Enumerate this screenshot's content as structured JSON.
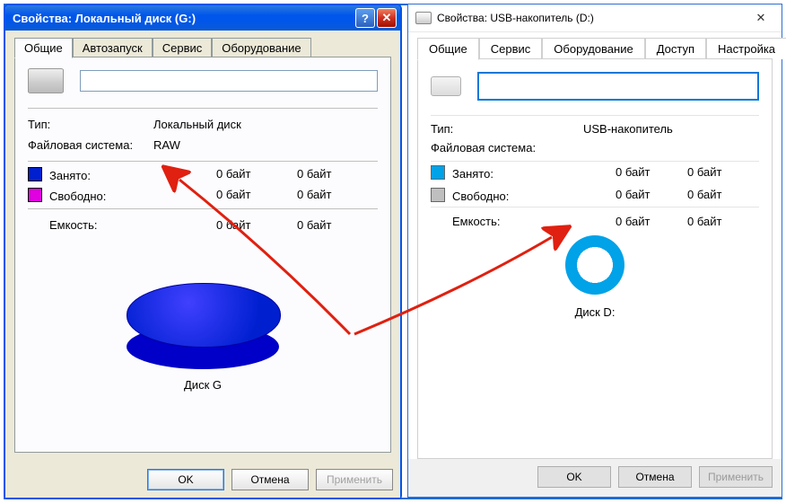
{
  "xp": {
    "title": "Свойства: Локальный диск (G:)",
    "tabs": [
      "Общие",
      "Автозапуск",
      "Сервис",
      "Оборудование"
    ],
    "type_label": "Тип:",
    "type_value": "Локальный диск",
    "fs_label": "Файловая система:",
    "fs_value": "RAW",
    "used_label": "Занято:",
    "used_bytes": "0 байт",
    "used_size": "0 байт",
    "free_label": "Свободно:",
    "free_bytes": "0 байт",
    "free_size": "0 байт",
    "cap_label": "Емкость:",
    "cap_bytes": "0 байт",
    "cap_size": "0 байт",
    "disk_label": "Диск G",
    "ok": "OK",
    "cancel": "Отмена",
    "apply": "Применить"
  },
  "w10": {
    "title": "Свойства: USB-накопитель (D:)",
    "tabs": [
      "Общие",
      "Сервис",
      "Оборудование",
      "Доступ",
      "Настройка"
    ],
    "type_label": "Тип:",
    "type_value": "USB-накопитель",
    "fs_label": "Файловая система:",
    "fs_value": "",
    "used_label": "Занято:",
    "used_bytes": "0 байт",
    "used_size": "0 байт",
    "free_label": "Свободно:",
    "free_bytes": "0 байт",
    "free_size": "0 байт",
    "cap_label": "Емкость:",
    "cap_bytes": "0 байт",
    "cap_size": "0 байт",
    "disk_label": "Диск D:",
    "ok": "OK",
    "cancel": "Отмена",
    "apply": "Применить"
  }
}
